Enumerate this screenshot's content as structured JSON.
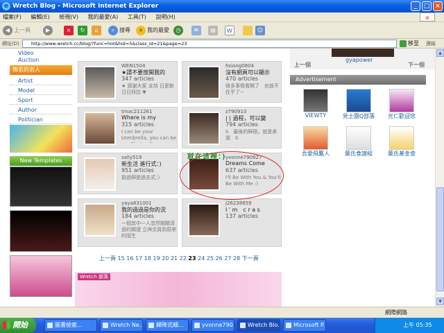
{
  "window": {
    "title": "Wretch Blog - Microsoft Internet Explorer"
  },
  "menu": [
    "檔案(F)",
    "編輯(E)",
    "檢視(V)",
    "我的最愛(A)",
    "工具(T)",
    "說明(H)"
  ],
  "toolbar": {
    "back": "上一頁",
    "search": "搜尋",
    "favorites": "我的最愛"
  },
  "address": {
    "label": "網址(D)",
    "url": "http://www.wretch.cc/blog/?func=hot&hid=5&class_id=21&page=23",
    "go": "移至",
    "links": "連結"
  },
  "sidebar": {
    "top_item": "Video",
    "auction": "Auction",
    "celebs_header": "無名的名人",
    "celebs": [
      "Artist",
      "Model",
      "Sport",
      "Author",
      "Politician"
    ],
    "templates_header": "New Templates"
  },
  "cards": [
    {
      "name": "WEN1504",
      "title": "★請不要放開我的",
      "articles": "347 articles",
      "desc": "★ 感謝大家 支持 日更新 日日拜訪 ▼"
    },
    {
      "name": "hsiang0804",
      "title": "沒有網頁可以顯示",
      "articles": "470 articles",
      "desc": "很多事情看開了　也就不在乎了~"
    },
    {
      "name": "tmac211261",
      "title": "Where is my",
      "articles": "315 articles",
      "desc": "I can be your Unmbrella, you can be my Cinderalla"
    },
    {
      "name": "z790910",
      "title": "| | 過程，可以變",
      "articles": "794 articles",
      "desc": "δ　最後的歸宿，就是承諾　δ"
    },
    {
      "name": "sally519",
      "title": "新生活 進行式：)",
      "articles": "951 articles",
      "desc": "拋過歸是過去式：)"
    },
    {
      "name": "yvonne790827",
      "title": "Dreams Come",
      "articles": "637 articles",
      "desc": "I'll Be With You & You'll Be With Me :)"
    },
    {
      "name": "yaya831001",
      "title": "我的過過是你的況",
      "articles": "184 articles",
      "desc": "一個其中一人忽然關關清過的關證 立與交員到原來的陌生"
    },
    {
      "name": "j26238659",
      "title": "I ' m　c r a s",
      "articles": "137 articles",
      "desc": ""
    }
  ],
  "pager": {
    "prev": "上一頁",
    "pages": [
      "15",
      "16",
      "17",
      "18",
      "19",
      "20",
      "21",
      "22"
    ],
    "current": "23",
    "pages_after": [
      "24",
      "25",
      "26",
      "27",
      "28"
    ],
    "next": "下一頁"
  },
  "banner": {
    "label": "Wretch 部落"
  },
  "right": {
    "prev": "上一個",
    "next": "下一個",
    "name": "gyapower",
    "ad_header": "Advertisement",
    "ads": [
      "VIEWTY",
      "見士園Q部落",
      "光仁歡迎您",
      "吾愛飛鷹人",
      "葉氏食譜組",
      "葉氏基金會"
    ]
  },
  "annotation": "就在這裡：)",
  "status": {
    "zone": "網際網路"
  },
  "taskbar": {
    "start": "開始",
    "tasks": [
      "圖書檢索...",
      "Wretch Ne...",
      "歸降式細...",
      "yvonne790...",
      "Wretch Blo...",
      "Microsoft P..."
    ],
    "clock": "上午 05:35"
  }
}
